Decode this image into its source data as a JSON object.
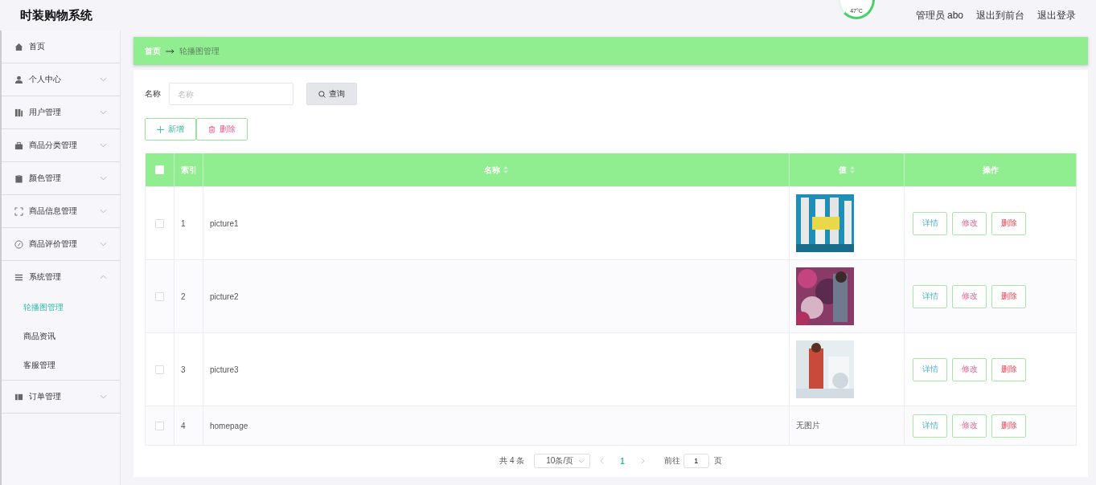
{
  "header": {
    "title": "时装购物系统",
    "temperature": "47°C",
    "links": [
      "管理员 abo",
      "退出到前台",
      "退出登录"
    ]
  },
  "sidebar": {
    "items": [
      {
        "label": "首页",
        "kind": "link"
      },
      {
        "label": "个人中心",
        "kind": "menu",
        "expanded": false
      },
      {
        "label": "用户管理",
        "kind": "menu",
        "expanded": false
      },
      {
        "label": "商品分类管理",
        "kind": "menu",
        "expanded": false
      },
      {
        "label": "颜色管理",
        "kind": "menu",
        "expanded": false
      },
      {
        "label": "商品信息管理",
        "kind": "menu",
        "expanded": false
      },
      {
        "label": "商品评价管理",
        "kind": "menu",
        "expanded": false
      },
      {
        "label": "系统管理",
        "kind": "menu",
        "expanded": true,
        "children": [
          {
            "label": "轮播图管理",
            "selected": true
          },
          {
            "label": "商品资讯",
            "selected": false
          },
          {
            "label": "客服管理",
            "selected": false
          }
        ]
      },
      {
        "label": "订单管理",
        "kind": "menu",
        "expanded": false
      }
    ]
  },
  "breadcrumb": [
    "首页",
    "轮播图管理"
  ],
  "search": {
    "label": "名称",
    "placeholder": "名称",
    "button": "查询"
  },
  "actions": [
    {
      "label": "新增",
      "kind": "add"
    },
    {
      "label": "删除",
      "kind": "delete"
    }
  ],
  "table": {
    "columns": [
      "索引",
      "名称",
      "值",
      "操作"
    ],
    "header_checked": false,
    "rows": [
      {
        "index": "1",
        "name": "picture1",
        "checked": false,
        "value": {
          "kind": "picture"
        },
        "buttons": [
          "详情",
          "修改",
          "删除"
        ]
      },
      {
        "index": "2",
        "name": "picture2",
        "checked": false,
        "value": {
          "kind": "picture"
        },
        "buttons": [
          "详情",
          "修改",
          "删除"
        ]
      },
      {
        "index": "3",
        "name": "picture3",
        "checked": false,
        "value": {
          "kind": "picture"
        },
        "buttons": [
          "详情",
          "修改",
          "删除"
        ]
      },
      {
        "index": "4",
        "name": "homepage",
        "checked": false,
        "value": {
          "kind": "text",
          "text": "无图片"
        },
        "buttons": [
          "详情",
          "修改",
          "删除"
        ]
      }
    ]
  },
  "pagination": {
    "total": "共 4 条",
    "page_size": "10条/页",
    "pages": [
      {
        "label": "1",
        "selected": true
      }
    ],
    "goto_label": "前往",
    "goto_value": "1",
    "goto_suffix": "页"
  }
}
